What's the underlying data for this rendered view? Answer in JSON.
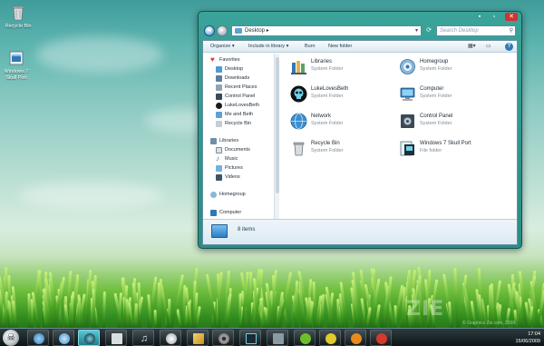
{
  "desktop": {
    "icons": [
      {
        "label": "Recycle Bin"
      },
      {
        "label": "Windows 7 Skull Port"
      }
    ],
    "watermark": "ZIE",
    "watermark_sub": "© Graphics Zie.com, 2009"
  },
  "window": {
    "title_controls": {
      "minimize": "▪",
      "maximize": "▫",
      "close": "✕"
    },
    "address": {
      "location": "Desktop",
      "separator": "▸"
    },
    "search": {
      "placeholder": "Search Desktop"
    },
    "toolbar": {
      "organize": "Organize ▾",
      "include_in_library": "Include in library ▾",
      "burn": "Burn",
      "new_folder": "New folder"
    },
    "nav": {
      "favorites_header": "Favorites",
      "favorites": [
        "Desktop",
        "Downloads",
        "Recent Places",
        "Control Panel",
        "LukeLovesBeth",
        "Me and Beth",
        "Recycle Bin"
      ],
      "libraries_header": "Libraries",
      "libraries": [
        "Documents",
        "Music",
        "Pictures",
        "Videos"
      ],
      "homegroup": "Homegroup",
      "computer": "Computer"
    },
    "files": [
      {
        "name": "Libraries",
        "type": "System Folder",
        "icon": "libraries-icon"
      },
      {
        "name": "Homegroup",
        "type": "System Folder",
        "icon": "homegroup-icon"
      },
      {
        "name": "LukeLovesBeth",
        "type": "System Folder",
        "icon": "skull-user-icon"
      },
      {
        "name": "Computer",
        "type": "System Folder",
        "icon": "computer-icon"
      },
      {
        "name": "Network",
        "type": "System Folder",
        "icon": "network-icon"
      },
      {
        "name": "Control Panel",
        "type": "System Folder",
        "icon": "control-panel-icon"
      },
      {
        "name": "Recycle Bin",
        "type": "System Folder",
        "icon": "recycle-bin-icon"
      },
      {
        "name": "Windows 7 Skull Port",
        "type": "File folder",
        "icon": "folder-icon"
      }
    ],
    "details": {
      "count": "8 items"
    }
  },
  "taskbar": {
    "clock": {
      "time": "17:04",
      "date": "15/06/2009"
    }
  },
  "colors": {
    "accent": "#2a8c86",
    "window_frame": "#3aa39a"
  }
}
